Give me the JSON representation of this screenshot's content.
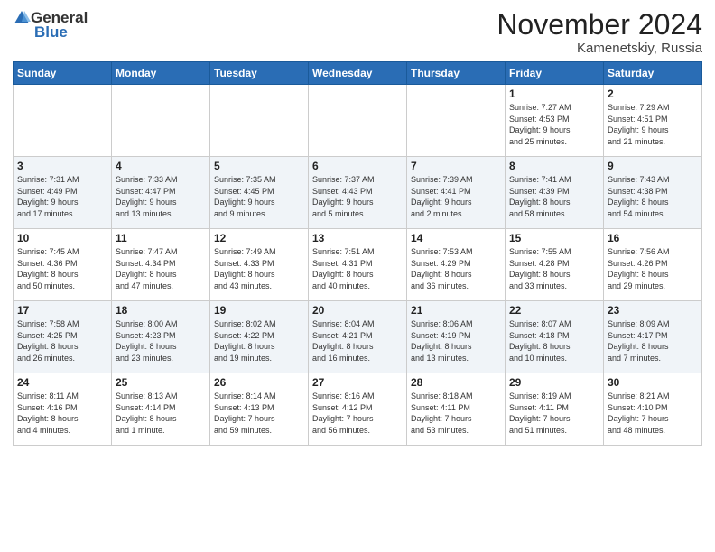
{
  "header": {
    "logo_general": "General",
    "logo_blue": "Blue",
    "month_title": "November 2024",
    "location": "Kamenetskiy, Russia"
  },
  "weekdays": [
    "Sunday",
    "Monday",
    "Tuesday",
    "Wednesday",
    "Thursday",
    "Friday",
    "Saturday"
  ],
  "weeks": [
    [
      {
        "day": "",
        "info": ""
      },
      {
        "day": "",
        "info": ""
      },
      {
        "day": "",
        "info": ""
      },
      {
        "day": "",
        "info": ""
      },
      {
        "day": "",
        "info": ""
      },
      {
        "day": "1",
        "info": "Sunrise: 7:27 AM\nSunset: 4:53 PM\nDaylight: 9 hours\nand 25 minutes."
      },
      {
        "day": "2",
        "info": "Sunrise: 7:29 AM\nSunset: 4:51 PM\nDaylight: 9 hours\nand 21 minutes."
      }
    ],
    [
      {
        "day": "3",
        "info": "Sunrise: 7:31 AM\nSunset: 4:49 PM\nDaylight: 9 hours\nand 17 minutes."
      },
      {
        "day": "4",
        "info": "Sunrise: 7:33 AM\nSunset: 4:47 PM\nDaylight: 9 hours\nand 13 minutes."
      },
      {
        "day": "5",
        "info": "Sunrise: 7:35 AM\nSunset: 4:45 PM\nDaylight: 9 hours\nand 9 minutes."
      },
      {
        "day": "6",
        "info": "Sunrise: 7:37 AM\nSunset: 4:43 PM\nDaylight: 9 hours\nand 5 minutes."
      },
      {
        "day": "7",
        "info": "Sunrise: 7:39 AM\nSunset: 4:41 PM\nDaylight: 9 hours\nand 2 minutes."
      },
      {
        "day": "8",
        "info": "Sunrise: 7:41 AM\nSunset: 4:39 PM\nDaylight: 8 hours\nand 58 minutes."
      },
      {
        "day": "9",
        "info": "Sunrise: 7:43 AM\nSunset: 4:38 PM\nDaylight: 8 hours\nand 54 minutes."
      }
    ],
    [
      {
        "day": "10",
        "info": "Sunrise: 7:45 AM\nSunset: 4:36 PM\nDaylight: 8 hours\nand 50 minutes."
      },
      {
        "day": "11",
        "info": "Sunrise: 7:47 AM\nSunset: 4:34 PM\nDaylight: 8 hours\nand 47 minutes."
      },
      {
        "day": "12",
        "info": "Sunrise: 7:49 AM\nSunset: 4:33 PM\nDaylight: 8 hours\nand 43 minutes."
      },
      {
        "day": "13",
        "info": "Sunrise: 7:51 AM\nSunset: 4:31 PM\nDaylight: 8 hours\nand 40 minutes."
      },
      {
        "day": "14",
        "info": "Sunrise: 7:53 AM\nSunset: 4:29 PM\nDaylight: 8 hours\nand 36 minutes."
      },
      {
        "day": "15",
        "info": "Sunrise: 7:55 AM\nSunset: 4:28 PM\nDaylight: 8 hours\nand 33 minutes."
      },
      {
        "day": "16",
        "info": "Sunrise: 7:56 AM\nSunset: 4:26 PM\nDaylight: 8 hours\nand 29 minutes."
      }
    ],
    [
      {
        "day": "17",
        "info": "Sunrise: 7:58 AM\nSunset: 4:25 PM\nDaylight: 8 hours\nand 26 minutes."
      },
      {
        "day": "18",
        "info": "Sunrise: 8:00 AM\nSunset: 4:23 PM\nDaylight: 8 hours\nand 23 minutes."
      },
      {
        "day": "19",
        "info": "Sunrise: 8:02 AM\nSunset: 4:22 PM\nDaylight: 8 hours\nand 19 minutes."
      },
      {
        "day": "20",
        "info": "Sunrise: 8:04 AM\nSunset: 4:21 PM\nDaylight: 8 hours\nand 16 minutes."
      },
      {
        "day": "21",
        "info": "Sunrise: 8:06 AM\nSunset: 4:19 PM\nDaylight: 8 hours\nand 13 minutes."
      },
      {
        "day": "22",
        "info": "Sunrise: 8:07 AM\nSunset: 4:18 PM\nDaylight: 8 hours\nand 10 minutes."
      },
      {
        "day": "23",
        "info": "Sunrise: 8:09 AM\nSunset: 4:17 PM\nDaylight: 8 hours\nand 7 minutes."
      }
    ],
    [
      {
        "day": "24",
        "info": "Sunrise: 8:11 AM\nSunset: 4:16 PM\nDaylight: 8 hours\nand 4 minutes."
      },
      {
        "day": "25",
        "info": "Sunrise: 8:13 AM\nSunset: 4:14 PM\nDaylight: 8 hours\nand 1 minute."
      },
      {
        "day": "26",
        "info": "Sunrise: 8:14 AM\nSunset: 4:13 PM\nDaylight: 7 hours\nand 59 minutes."
      },
      {
        "day": "27",
        "info": "Sunrise: 8:16 AM\nSunset: 4:12 PM\nDaylight: 7 hours\nand 56 minutes."
      },
      {
        "day": "28",
        "info": "Sunrise: 8:18 AM\nSunset: 4:11 PM\nDaylight: 7 hours\nand 53 minutes."
      },
      {
        "day": "29",
        "info": "Sunrise: 8:19 AM\nSunset: 4:11 PM\nDaylight: 7 hours\nand 51 minutes."
      },
      {
        "day": "30",
        "info": "Sunrise: 8:21 AM\nSunset: 4:10 PM\nDaylight: 7 hours\nand 48 minutes."
      }
    ]
  ]
}
